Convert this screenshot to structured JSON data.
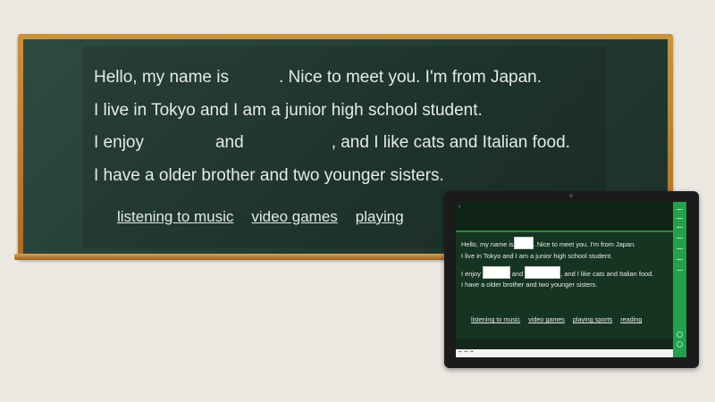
{
  "board": {
    "line1a": "Hello, my name is",
    "line1b": ". Nice to meet you. I'm from Japan.",
    "line2": "I live in Tokyo and I am a junior high school student.",
    "line3a": "I enjoy",
    "line3b": "and",
    "line3c": ", and I like cats and Italian food.",
    "line4": "I have a older brother and two younger sisters.",
    "choices": [
      "listening to music",
      "video games",
      "playing"
    ]
  },
  "tablet": {
    "line1a": "Hello, my name is",
    "line1b": ". Nice to meet you. I'm from Japan.",
    "line2": "I live in Tokyo and I am a junior high school student.",
    "line3a": "I enjoy",
    "line3b": "and",
    "line3c": ", and I like cats and Italian food.",
    "line4": "I have a older brother and two younger sisters.",
    "choices": [
      "listening to music",
      "video games",
      "playing sports",
      "reading"
    ],
    "back_icon": "back-arrow-icon",
    "accent": "#23a04a"
  },
  "colors": {
    "board": "#2a4338",
    "frame": "#b98035",
    "wall": "#ebe8e1"
  }
}
